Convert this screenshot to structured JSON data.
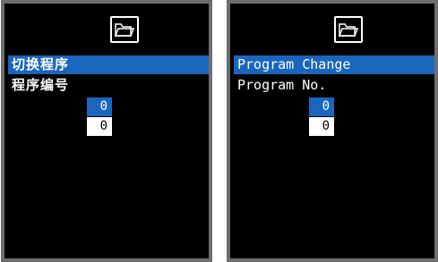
{
  "screens": [
    {
      "language": "chinese",
      "header_icon": "folder-icon",
      "menu_selected_label": "切换程序",
      "menu_item_label": "程序编号",
      "program_number_selected": "0",
      "program_number_value": "0"
    },
    {
      "language": "english",
      "header_icon": "folder-icon",
      "menu_selected_label": "Program Change",
      "menu_item_label": "Program No.",
      "program_number_selected": "0",
      "program_number_value": "0"
    }
  ],
  "colors": {
    "screen_background": "#000000",
    "bezel": "#6e6e6e",
    "highlight": "#1a66bd",
    "text": "#ffffff"
  }
}
